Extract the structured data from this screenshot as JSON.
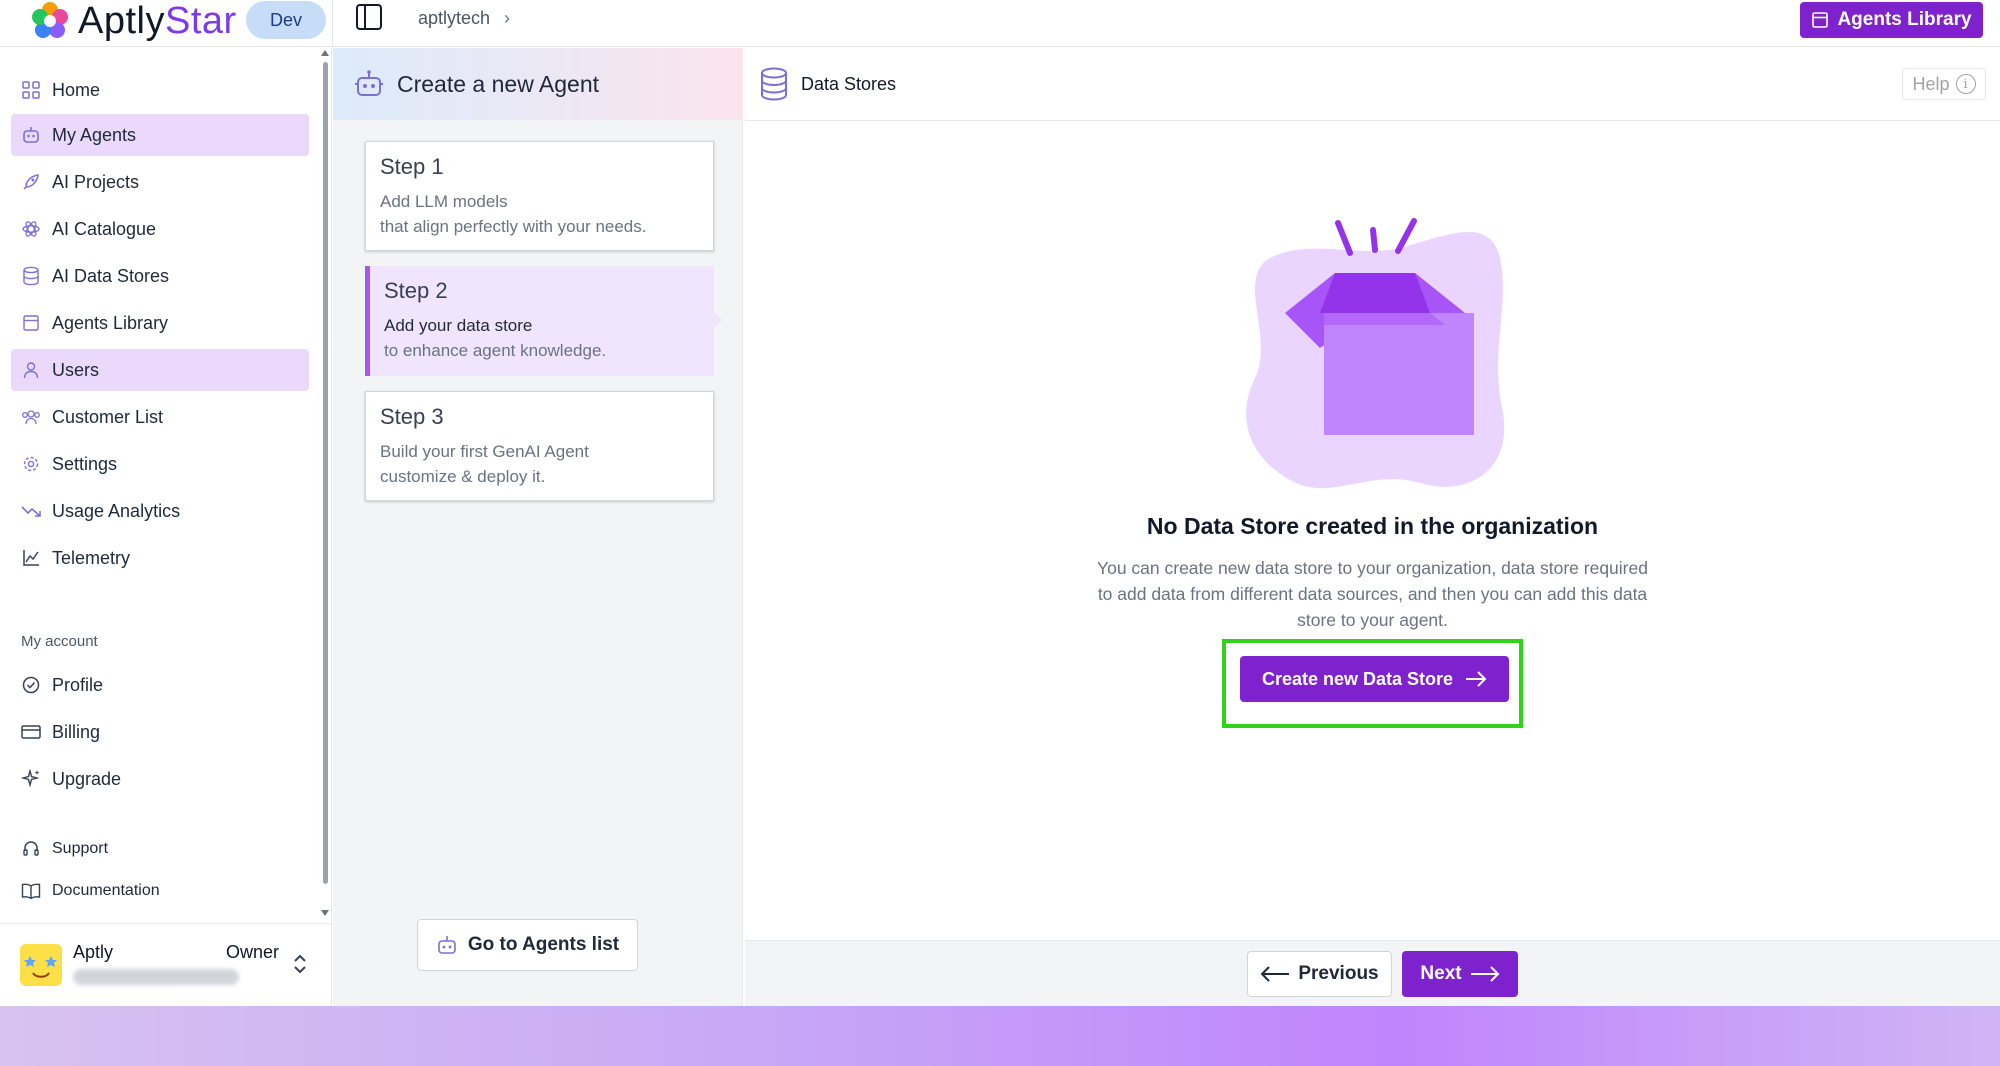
{
  "topbar": {
    "brand_prefix": "Aptly",
    "brand_suffix": "Star",
    "env": "Dev",
    "breadcrumb": "aptlytech",
    "agents_library_button": "Agents Library"
  },
  "sidebar": {
    "items": [
      {
        "label": "Home",
        "icon": "home-icon"
      },
      {
        "label": "My Agents",
        "icon": "robot-icon",
        "active": true
      },
      {
        "label": "AI Projects",
        "icon": "rocket-icon"
      },
      {
        "label": "AI Catalogue",
        "icon": "atom-icon"
      },
      {
        "label": "AI Data Stores",
        "icon": "database-icon"
      },
      {
        "label": "Agents Library",
        "icon": "library-icon"
      },
      {
        "label": "Users",
        "icon": "user-icon",
        "active": true
      },
      {
        "label": "Customer List",
        "icon": "users-group-icon"
      },
      {
        "label": "Settings",
        "icon": "gear-icon"
      },
      {
        "label": "Usage Analytics",
        "icon": "trend-down-icon"
      },
      {
        "label": "Telemetry",
        "icon": "line-chart-icon"
      }
    ],
    "account_label": "My account",
    "account_items": [
      {
        "label": "Profile",
        "icon": "check-circle-icon"
      },
      {
        "label": "Billing",
        "icon": "credit-card-icon"
      },
      {
        "label": "Upgrade",
        "icon": "sparkle-icon"
      }
    ],
    "support_items": [
      {
        "label": "Support",
        "icon": "headset-icon"
      },
      {
        "label": "Documentation",
        "icon": "book-icon"
      }
    ],
    "user": {
      "name": "Aptly",
      "role": "Owner"
    }
  },
  "steps": {
    "header": "Create a new Agent",
    "items": [
      {
        "title": "Step 1",
        "line1": "Add LLM models",
        "line2": "that align perfectly with your needs."
      },
      {
        "title": "Step 2",
        "line1": "Add your data store",
        "line2": "to enhance agent knowledge.",
        "current": true
      },
      {
        "title": "Step 3",
        "line1": "Build your first GenAI Agent",
        "line2": "customize & deploy it."
      }
    ],
    "goto_button": "Go to Agents list"
  },
  "main": {
    "title": "Data Stores",
    "help": "Help",
    "empty_title": "No Data Store created in the organization",
    "empty_desc": "You can create new data store to your organization, data store required to add data from different data sources, and then you can add this data store to your agent.",
    "create_button": "Create new Data Store",
    "previous_button": "Previous",
    "next_button": "Next"
  },
  "colors": {
    "primary": "#7e22ce",
    "active_nav": "#ead9fb",
    "highlight": "#2ed31a"
  }
}
